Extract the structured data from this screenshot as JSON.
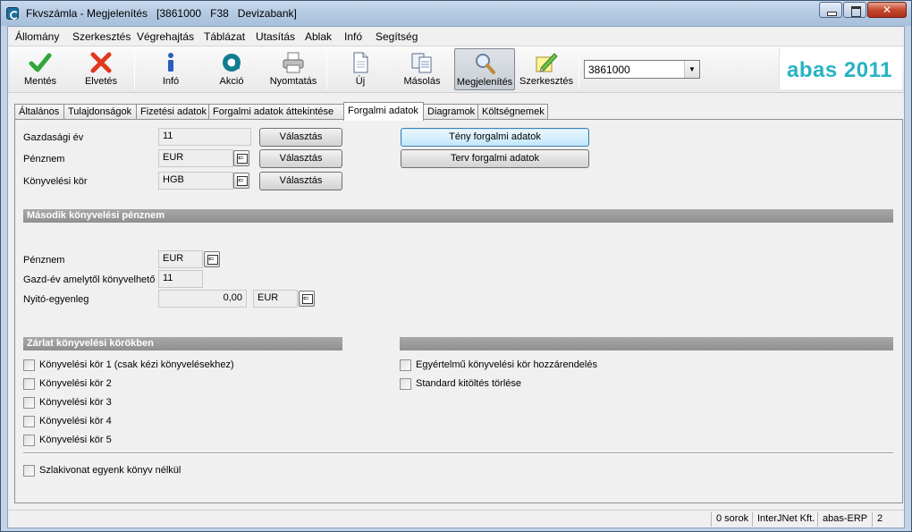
{
  "window": {
    "title_app": "Fkvszámla - Megjelenítés",
    "title_record": "[3861000",
    "title_code": "F38",
    "title_name": "Devizabank]"
  },
  "menu": [
    "Állomány",
    "Szerkesztés",
    "Végrehajtás",
    "Táblázat",
    "Utasítás",
    "Ablak",
    "Infó",
    "Segítség"
  ],
  "toolbar": {
    "buttons": [
      {
        "label": "Mentés",
        "icon": "check-icon",
        "color": "#2fa83a"
      },
      {
        "label": "Elvetés",
        "icon": "cross-icon",
        "color": "#e0391e"
      },
      {
        "label": "Infó",
        "icon": "info-icon",
        "color": "#2a5fbf"
      },
      {
        "label": "Akció",
        "icon": "abas-action-icon",
        "color": "#0f7d92"
      },
      {
        "label": "Nyomtatás",
        "icon": "printer-icon"
      },
      {
        "label": "Új",
        "icon": "new-document-icon"
      },
      {
        "label": "Másolás",
        "icon": "copy-icon"
      },
      {
        "label": "Megjelenítés",
        "icon": "magnifier-icon",
        "active": true
      },
      {
        "label": "Szerkesztés",
        "icon": "edit-icon"
      }
    ],
    "record_combo": "3861000",
    "logo": "abas 2011",
    "logo_color": "#27b3c3"
  },
  "tabs": [
    "Általános",
    "Tulajdonságok",
    "Fizetési adatok",
    "Forgalmi adatok áttekintése",
    "Forgalmi adatok",
    "Diagramok",
    "Költségnemek"
  ],
  "active_tab": "Forgalmi adatok",
  "form": {
    "gazdasagi_ev": {
      "label": "Gazdasági év",
      "value": "11",
      "button": "Választás"
    },
    "penznem": {
      "label": "Pénznem",
      "value": "EUR",
      "button": "Választás"
    },
    "konyvelesi_kor": {
      "label": "Könyvelési kör",
      "value": "HGB",
      "button": "Választás"
    },
    "teny_button": "Tény forgalmi adatok",
    "terv_button": "Terv forgalmi adatok"
  },
  "second_currency": {
    "header": "Második könyvelési pénznem",
    "penznem": {
      "label": "Pénznem",
      "value": "EUR"
    },
    "gazd_ev": {
      "label": "Gazd-év amelytől könyvelhető",
      "value": "11"
    },
    "nyito": {
      "label": "Nyitó-egyenleg",
      "value": "0,00",
      "currency": "EUR"
    }
  },
  "closing": {
    "header": "Zárlat könyvelési körökben",
    "items": [
      "Könyvelési kör 1 (csak kézi könyvelésekhez)",
      "Könyvelési kör 2",
      "Könyvelési kör 3",
      "Könyvelési kör 4",
      "Könyvelési kör 5"
    ],
    "right_items": [
      "Egyértelmű könyvelési kör hozzárendelés",
      "Standard kitöltés törlése"
    ],
    "bottom_item": "Szlakivonat egyenk könyv nélkül"
  },
  "status": {
    "rows": "0 sorok",
    "company": "InterJNet Kft.",
    "product": "abas-ERP",
    "number": "2"
  }
}
